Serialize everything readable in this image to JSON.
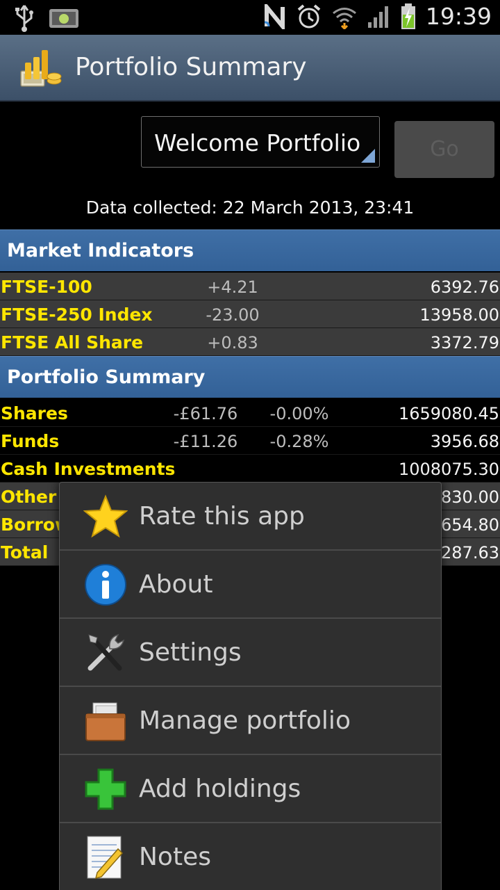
{
  "status_bar": {
    "time": "19:39",
    "battery_charging": true
  },
  "header": {
    "title": "Portfolio Summary"
  },
  "selector": {
    "value": "Welcome Portfolio",
    "go_label": "Go"
  },
  "collected": "Data collected:  22 March 2013, 23:41",
  "market": {
    "title": "Market Indicators",
    "rows": [
      {
        "name": "FTSE-100",
        "change": "+4.21",
        "value": "6392.76"
      },
      {
        "name": "FTSE-250 Index",
        "change": "-23.00",
        "value": "13958.00"
      },
      {
        "name": "FTSE All Share",
        "change": "+0.83",
        "value": "3372.79"
      }
    ]
  },
  "portfolio": {
    "title": "Portfolio Summary",
    "rows": [
      {
        "name": "Shares",
        "change": "-£61.76",
        "pct": "-0.00%",
        "value": "1659080.45"
      },
      {
        "name": "Funds",
        "change": "-£11.26",
        "pct": "-0.28%",
        "value": "3956.68"
      },
      {
        "name": "Cash Investments",
        "change": "",
        "pct": "",
        "value": "1008075.30"
      },
      {
        "name": "Other I",
        "change": "",
        "pct": "",
        "value": "830.00"
      },
      {
        "name": "Borrow",
        "change": "",
        "pct": "",
        "value": "654.80"
      },
      {
        "name": "Total",
        "change": "",
        "pct": "",
        "value": "287.63"
      }
    ]
  },
  "menu": {
    "items": [
      {
        "label": "Rate this app",
        "icon": "star-icon"
      },
      {
        "label": "About",
        "icon": "info-icon"
      },
      {
        "label": "Settings",
        "icon": "tools-icon"
      },
      {
        "label": "Manage portfolio",
        "icon": "briefcase-icon"
      },
      {
        "label": "Add holdings",
        "icon": "plus-icon"
      },
      {
        "label": "Notes",
        "icon": "notes-icon"
      }
    ]
  },
  "colors": {
    "accent": "#336197",
    "label_yellow": "#ffe600",
    "title_bar": "#4a5f77"
  }
}
